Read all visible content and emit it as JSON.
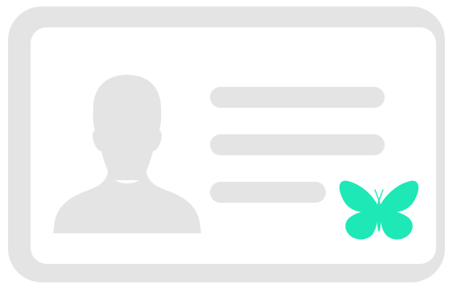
{
  "colors": {
    "background": "#ffffff",
    "card_frame": "#e4e4e4",
    "card_inner": "#ffffff",
    "placeholder": "#e4e4e4",
    "accent": "#1ee8b6"
  },
  "icons": {
    "card": "id-card-icon",
    "avatar": "person-silhouette-icon",
    "badge": "butterfly-icon"
  },
  "text_lines": [
    {
      "length": "long"
    },
    {
      "length": "long"
    },
    {
      "length": "short"
    }
  ]
}
